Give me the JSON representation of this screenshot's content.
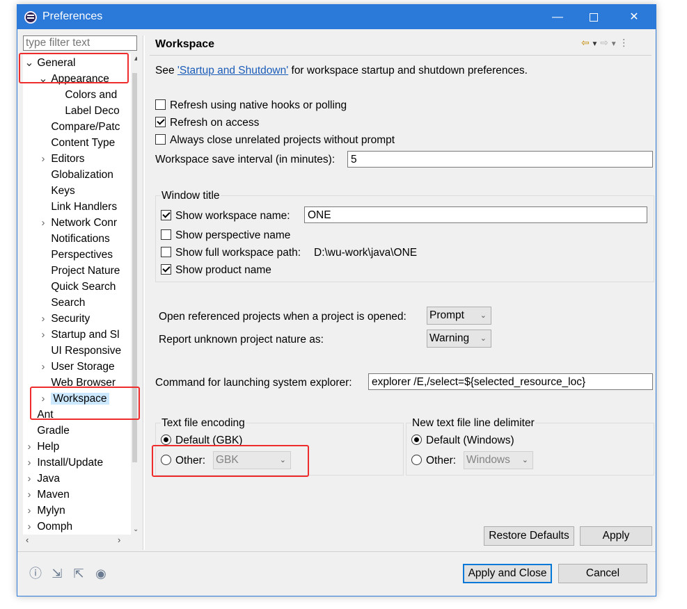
{
  "window": {
    "title": "Preferences"
  },
  "filter_placeholder": "type filter text",
  "tree": [
    {
      "label": "General",
      "level": 0,
      "arrow": "open"
    },
    {
      "label": "Appearance",
      "level": 1,
      "arrow": "open"
    },
    {
      "label": "Colors and",
      "level": 2,
      "arrow": ""
    },
    {
      "label": "Label Deco",
      "level": 2,
      "arrow": ""
    },
    {
      "label": "Compare/Patc",
      "level": 1,
      "arrow": ""
    },
    {
      "label": "Content Type",
      "level": 1,
      "arrow": ""
    },
    {
      "label": "Editors",
      "level": 1,
      "arrow": "closed"
    },
    {
      "label": "Globalization",
      "level": 1,
      "arrow": ""
    },
    {
      "label": "Keys",
      "level": 1,
      "arrow": ""
    },
    {
      "label": "Link Handlers",
      "level": 1,
      "arrow": ""
    },
    {
      "label": "Network Conr",
      "level": 1,
      "arrow": "closed"
    },
    {
      "label": "Notifications",
      "level": 1,
      "arrow": ""
    },
    {
      "label": "Perspectives",
      "level": 1,
      "arrow": ""
    },
    {
      "label": "Project Nature",
      "level": 1,
      "arrow": ""
    },
    {
      "label": "Quick Search",
      "level": 1,
      "arrow": ""
    },
    {
      "label": "Search",
      "level": 1,
      "arrow": ""
    },
    {
      "label": "Security",
      "level": 1,
      "arrow": "closed"
    },
    {
      "label": "Startup and Sl",
      "level": 1,
      "arrow": "closed"
    },
    {
      "label": "UI Responsive",
      "level": 1,
      "arrow": ""
    },
    {
      "label": "User Storage",
      "level": 1,
      "arrow": "closed"
    },
    {
      "label": "Web Browser",
      "level": 1,
      "arrow": ""
    },
    {
      "label": "Workspace",
      "level": 1,
      "arrow": "closed",
      "selected": true
    },
    {
      "label": "Ant",
      "level": 0,
      "arrow": ""
    },
    {
      "label": "Gradle",
      "level": 0,
      "arrow": ""
    },
    {
      "label": "Help",
      "level": 0,
      "arrow": "closed"
    },
    {
      "label": "Install/Update",
      "level": 0,
      "arrow": "closed"
    },
    {
      "label": "Java",
      "level": 0,
      "arrow": "closed"
    },
    {
      "label": "Maven",
      "level": 0,
      "arrow": "closed"
    },
    {
      "label": "Mylyn",
      "level": 0,
      "arrow": "closed"
    },
    {
      "label": "Oomph",
      "level": 0,
      "arrow": "closed"
    }
  ],
  "page": {
    "title": "Workspace",
    "intro_see": "See ",
    "intro_link": "'Startup and Shutdown'",
    "intro_rest": " for workspace startup and shutdown preferences.",
    "refresh_hooks": {
      "label": "Refresh using native hooks or polling",
      "checked": false
    },
    "refresh_access": {
      "label": "Refresh on access",
      "checked": true
    },
    "always_close": {
      "label": "Always close unrelated projects without prompt",
      "checked": false
    },
    "save_interval_label": "Workspace save interval (in minutes):",
    "save_interval_value": "5",
    "window_title_group": "Window title",
    "show_ws_name": {
      "label": "Show workspace name:",
      "checked": true
    },
    "ws_name_value": "ONE",
    "show_perspective": {
      "label": "Show perspective name",
      "checked": false
    },
    "show_full_path": {
      "label": "Show full workspace path:",
      "checked": false
    },
    "full_path_value": "D:\\wu-work\\java\\ONE",
    "show_product": {
      "label": "Show product name",
      "checked": true
    },
    "open_ref_label": "Open referenced projects when a project is opened:",
    "open_ref_value": "Prompt",
    "unknown_nature_label": "Report unknown project nature as:",
    "unknown_nature_value": "Warning",
    "explorer_label": "Command for launching system explorer:",
    "explorer_value": "explorer /E,/select=${selected_resource_loc}",
    "encoding_group": "Text file encoding",
    "enc_default": "Default (GBK)",
    "enc_other": "Other:",
    "enc_other_value": "GBK",
    "delim_group": "New text file line delimiter",
    "delim_default": "Default (Windows)",
    "delim_other": "Other:",
    "delim_other_value": "Windows",
    "restore_defaults": "Restore Defaults",
    "apply": "Apply"
  },
  "footer": {
    "apply_close": "Apply and Close",
    "cancel": "Cancel",
    "icons": [
      "help-icon",
      "import-icon",
      "export-icon",
      "record-icon"
    ]
  }
}
